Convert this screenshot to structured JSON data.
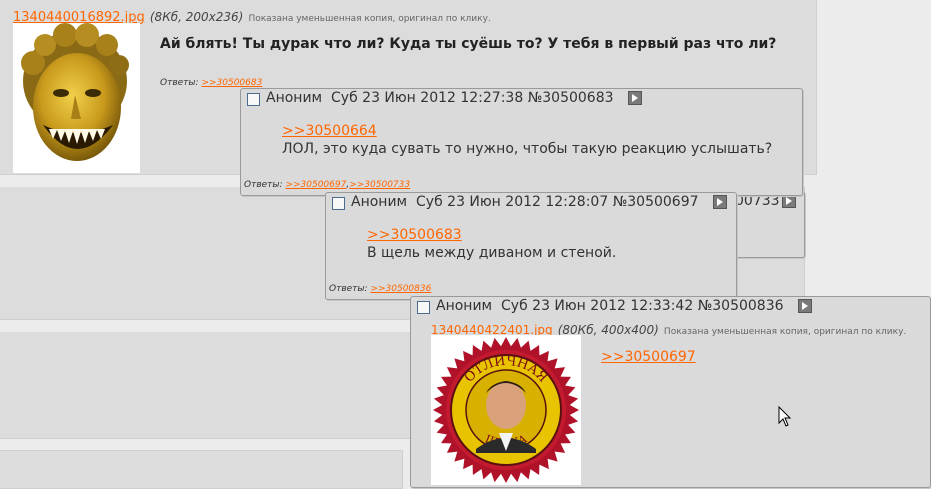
{
  "background_posts": {
    "first_post": {
      "file_link": "1340440016892.jpg",
      "file_meta": "(8Кб, 200x236)",
      "file_note": "Показана уменьшенная копия, оригинал по клику.",
      "message": "Ай блять! Ты дурак что ли? Куда ты суёшь то? У тебя в первый раз что ли?",
      "answers_label": "Ответы:",
      "answers_links": [
        ">>30500683"
      ]
    },
    "hidden_post_number_fragment": "00733"
  },
  "popups": [
    {
      "anon": "Аноним",
      "date": "Суб 23 Июн 2012 12:27:38",
      "number": "№30500683",
      "reply_link": ">>30500664",
      "message": "ЛОЛ, это куда сувать то нужно, чтобы такую реакцию услышать?",
      "answers_label": "Ответы:",
      "answers_links": [
        ">>30500697",
        ">>30500733"
      ]
    },
    {
      "anon": "Аноним",
      "date": "Суб 23 Июн 2012 12:28:07",
      "number": "№30500697",
      "reply_link": ">>30500683",
      "message": "В щель между диваном и стеной.",
      "answers_label": "Ответы:",
      "answers_links": [
        ">>30500836"
      ]
    },
    {
      "anon": "Аноним",
      "date": "Суб 23 Июн 2012 12:33:42",
      "number": "№30500836",
      "file_link": "1340440422401.jpg",
      "file_meta": "(80Кб, 400x400)",
      "file_note": "Показана уменьшенная копия, оригинал по клику.",
      "reply_link": ">>30500697",
      "seal_top_text": "ОТЛИЧНАЯ",
      "seal_bottom_text": "ШУТКА"
    }
  ],
  "colors": {
    "link": "#ff6600",
    "popup_bg": "#dadada",
    "post_bg": "#dcdcdc",
    "page_bg": "#ececec"
  }
}
